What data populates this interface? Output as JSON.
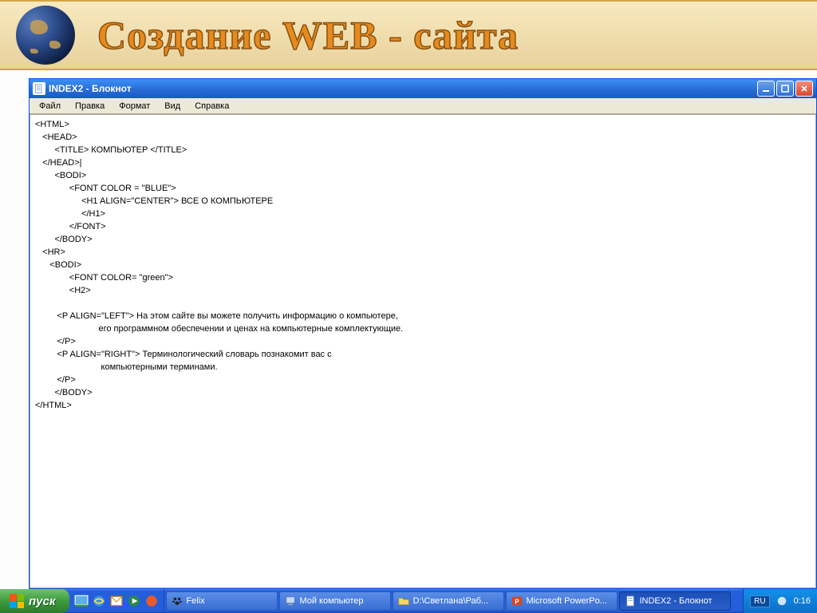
{
  "banner": {
    "title": "Создание WEB - сайта"
  },
  "window": {
    "title": "INDEX2 - Блокнот",
    "menu": {
      "file": "Файл",
      "edit": "Правка",
      "format": "Формат",
      "view": "Вид",
      "help": "Справка"
    },
    "content": "<HTML>\n   <HEAD>\n        <TITLE> КОМПЬЮТЕР </TITLE>\n   </HEAD>|\n        <BODI>\n              <FONT COLOR = \"BLUE\">\n                   <H1 ALIGN=\"CENTER\"> ВСЕ О КОМПЬЮТЕРЕ\n                   </H1>\n              </FONT>\n        </BODY>\n   <HR>\n      <BODI>\n              <FONT COLOR= \"green\">\n              <H2>\n\n         <P ALIGN=\"LEFT\"> На этом сайте вы можете получить информацию о компьютере,\n                          его программном обеспечении и ценах на компьютерные комплектующие.\n         </P>\n         <P ALIGN=\"RIGHT\"> Терминологический словарь познакомит вас с\n                           компьютерными терминами.\n         </P>\n        </BODY>\n</HTML>"
  },
  "taskbar": {
    "start": "пуск",
    "items": [
      {
        "label": "Felix",
        "icon": "paw-icon"
      },
      {
        "label": "Мой компьютер",
        "icon": "computer-icon"
      },
      {
        "label": "D:\\Светлана\\Раб...",
        "icon": "folder-icon"
      },
      {
        "label": "Microsoft PowerPo...",
        "icon": "powerpoint-icon"
      },
      {
        "label": "INDEX2 - Блокнот",
        "icon": "notepad-icon",
        "active": true
      }
    ],
    "lang": "RU",
    "clock": "0:16"
  },
  "colors": {
    "banner_bg": "#efdca8",
    "banner_text": "#e68a1e",
    "xp_blue": "#245edb",
    "xp_green": "#3e9b3e"
  }
}
